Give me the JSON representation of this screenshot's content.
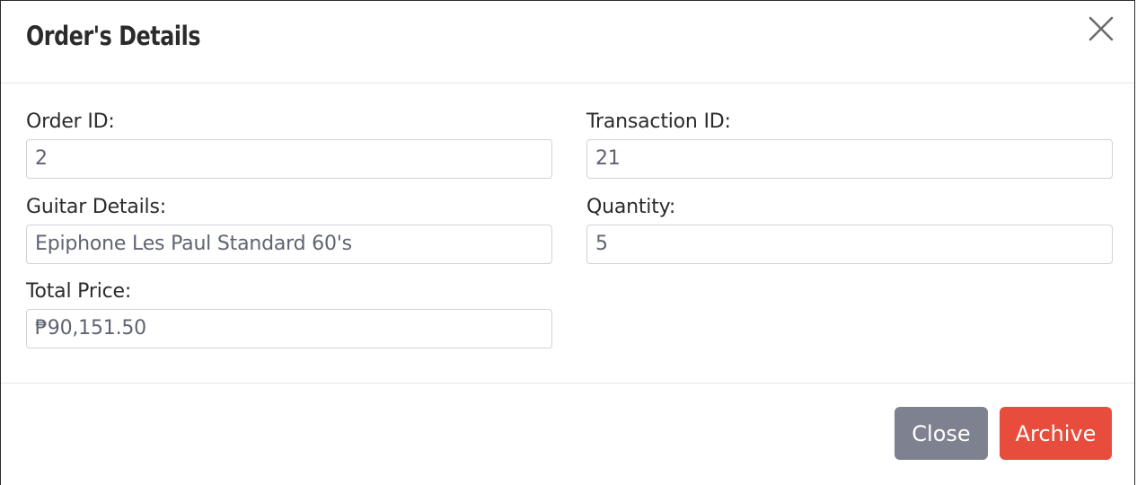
{
  "modal": {
    "title": "Order's Details"
  },
  "fields": {
    "order_id": {
      "label": "Order ID:",
      "value": "2"
    },
    "transaction_id": {
      "label": "Transaction ID:",
      "value": "21"
    },
    "guitar_details": {
      "label": "Guitar Details:",
      "value": "Epiphone Les Paul Standard 60's"
    },
    "quantity": {
      "label": "Quantity:",
      "value": "5"
    },
    "total_price": {
      "label": "Total Price:",
      "value": "₱90,151.50"
    }
  },
  "footer": {
    "close_label": "Close",
    "archive_label": "Archive"
  },
  "colors": {
    "close_button": "#7e8290",
    "archive_button": "#e74c3c",
    "title_text": "#2b2b2b"
  },
  "icons": {
    "dismiss": "close-icon"
  }
}
